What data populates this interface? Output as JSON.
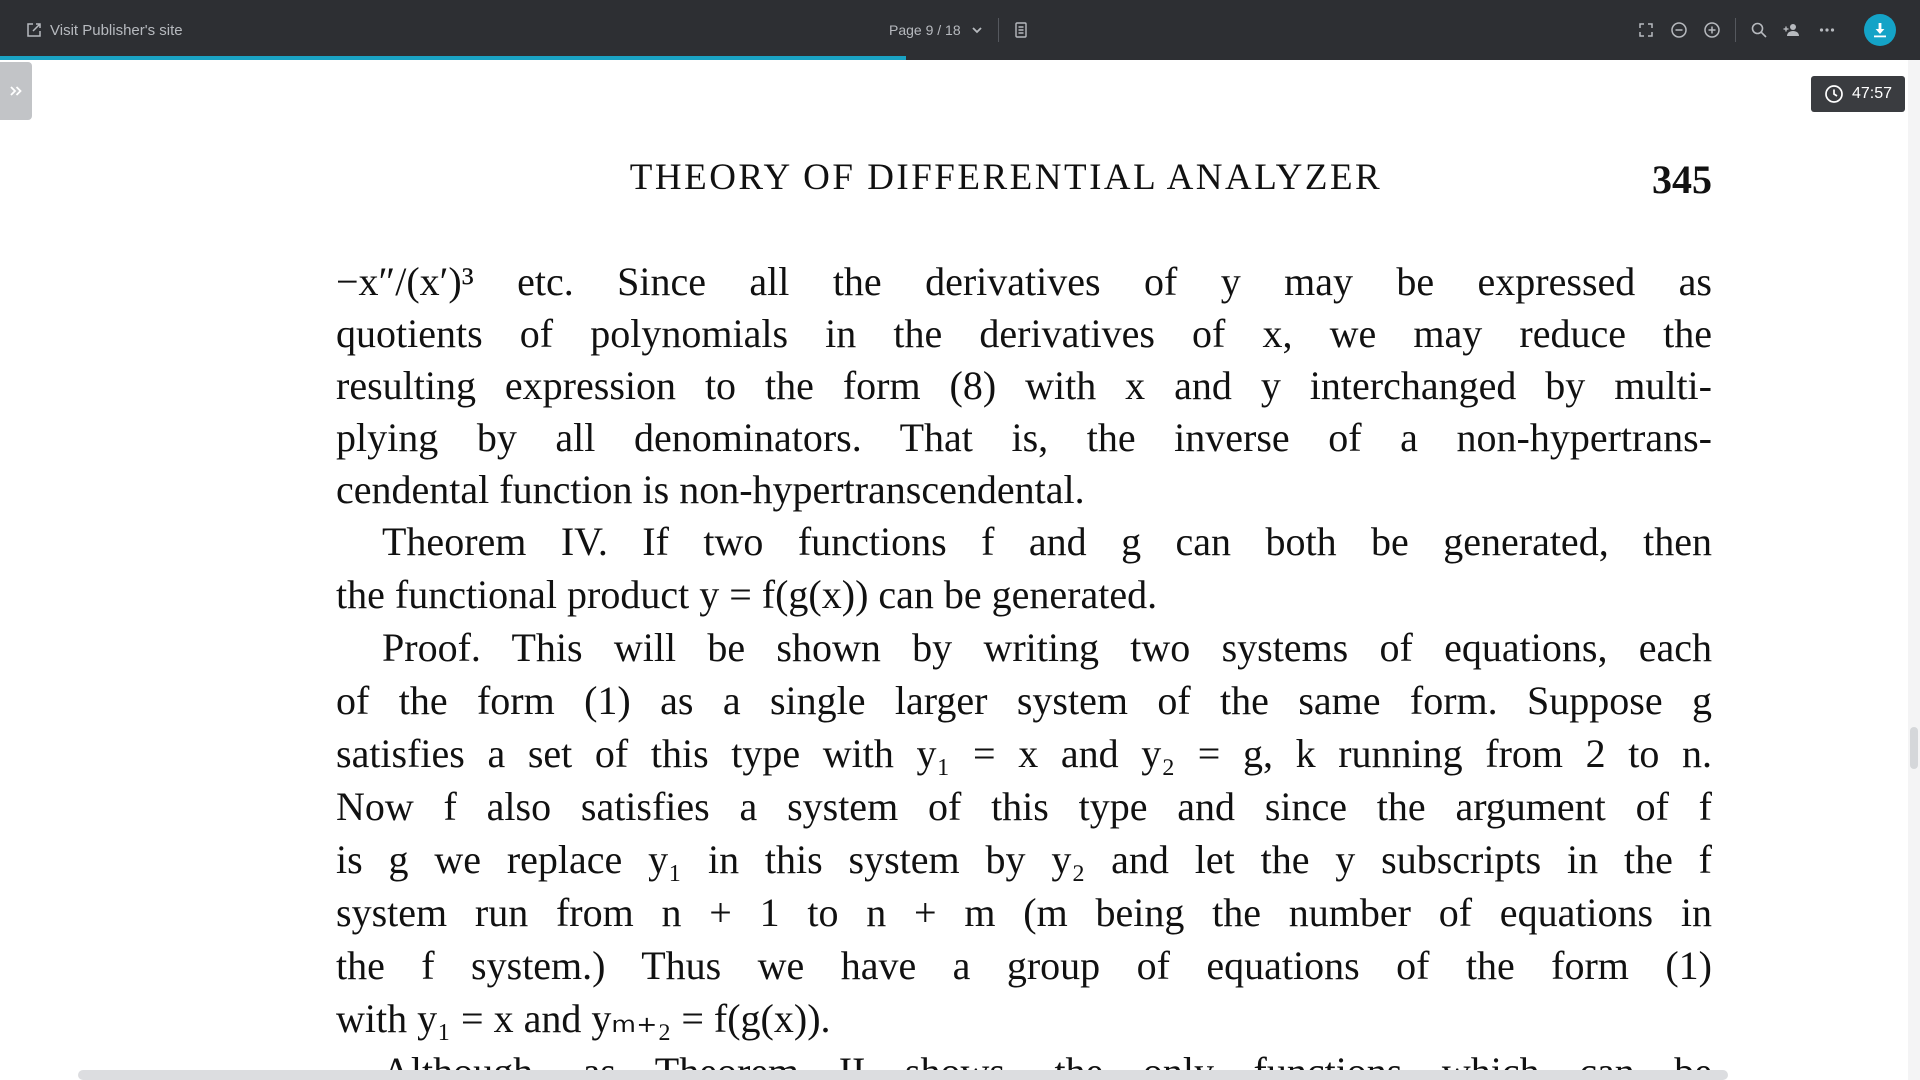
{
  "toolbar": {
    "publisher_link": "Visit Publisher's site",
    "page_indicator": "Page 9 / 18",
    "reading_progress": 0.472
  },
  "timer": {
    "value": "47:57"
  },
  "icons": {
    "external_link": "external-link-icon",
    "chevron": "chevron-down-icon",
    "page_view": "page-view-icon",
    "fullscreen": "fullscreen-icon",
    "zoom_out": "zoom-out-icon",
    "zoom_in": "zoom-in-icon",
    "search": "search-icon",
    "add_user": "add-user-icon",
    "more": "more-icon",
    "download": "download-icon",
    "sidebar": "chevron-double-right-icon",
    "clock": "clock-icon"
  },
  "colors": {
    "toolbar_bg": "#2d2f33",
    "accent": "#14a3c7"
  },
  "document": {
    "running_head": "THEORY OF DIFFERENTIAL ANALYZER",
    "page_number": "345",
    "lines": [
      "−x″/(x′)³ etc.  Since all the derivatives of y may be expressed as",
      "quotients of polynomials in the derivatives of x, we may reduce the",
      "resulting expression to the form (8) with x and y interchanged by multi-",
      "plying by all denominators.  That is, the inverse of a non-hypertrans-",
      "cendental function is non-hypertranscendental.",
      "Theorem IV.  If two functions f and g can both be generated, then",
      "the functional product y = f(g(x)) can be generated.",
      "Proof.  This will be shown by writing two systems of equations, each",
      "of the form (1) as a single larger system of the same form.  Suppose g",
      "satisfies a set of this type with y₁ = x and y₂ = g, k running from 2 to n.",
      "Now f also satisfies a system of this type and since the argument of f",
      "is g we replace y₁ in this system by y₂ and let the y subscripts in the f",
      "system run from n + 1 to n + m (m being the number of equations in",
      "the f system.)  Thus we have a group of equations of the form (1)",
      "with y₁ = x and yₘ₊₂ = f(g(x)).",
      "Although, as Theorem II shows, the only functions which can be"
    ]
  }
}
